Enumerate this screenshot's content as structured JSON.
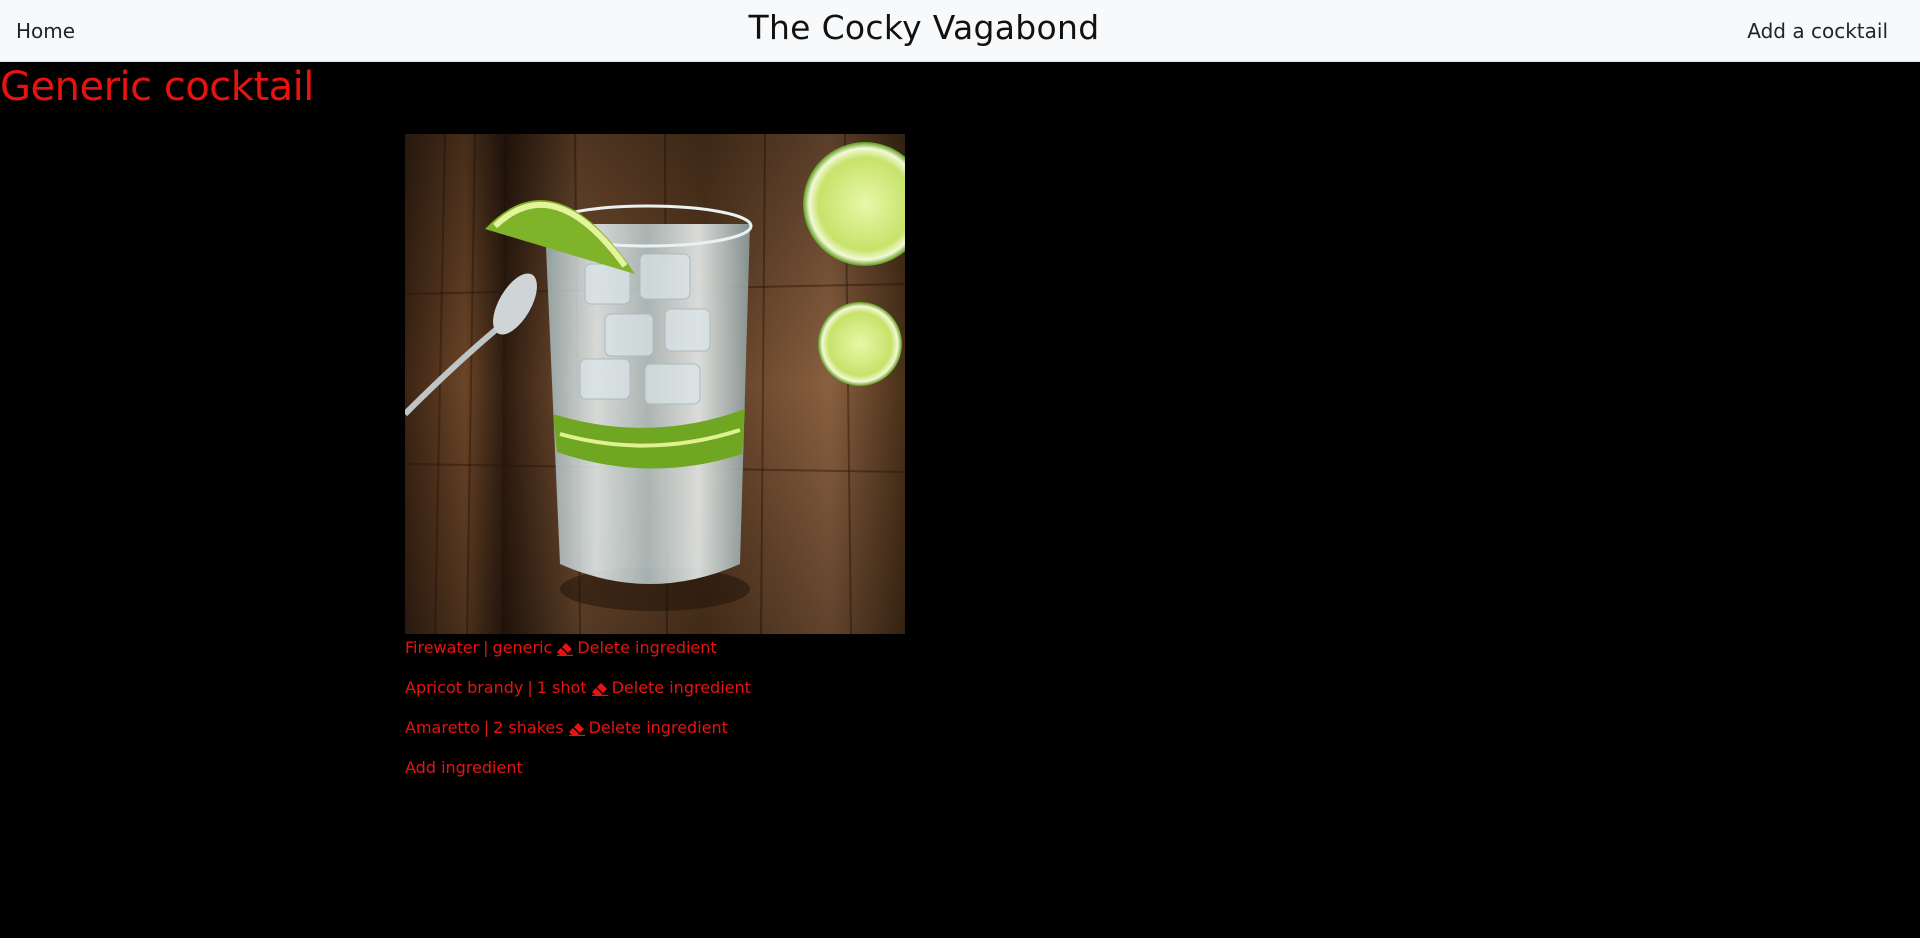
{
  "navbar": {
    "home_label": "Home",
    "brand_title": "The Cocky Vagabond",
    "add_label": "Add a cocktail"
  },
  "cocktail": {
    "name": "Generic cocktail"
  },
  "ingredients": [
    {
      "name": "Firewater",
      "separator": "|",
      "amount": "generic",
      "delete_label": "Delete ingredient"
    },
    {
      "name": "Apricot brandy",
      "separator": "|",
      "amount": "1 shot",
      "delete_label": "Delete ingredient"
    },
    {
      "name": "Amaretto",
      "separator": "|",
      "amount": "2 shakes",
      "delete_label": "Delete ingredient"
    }
  ],
  "add_ingredient_label": "Add ingredient",
  "icons": {
    "delete": "eraser-icon"
  },
  "colors": {
    "accent": "#e8130f",
    "navbar_bg": "#f8f9fa",
    "page_bg": "#000000"
  }
}
